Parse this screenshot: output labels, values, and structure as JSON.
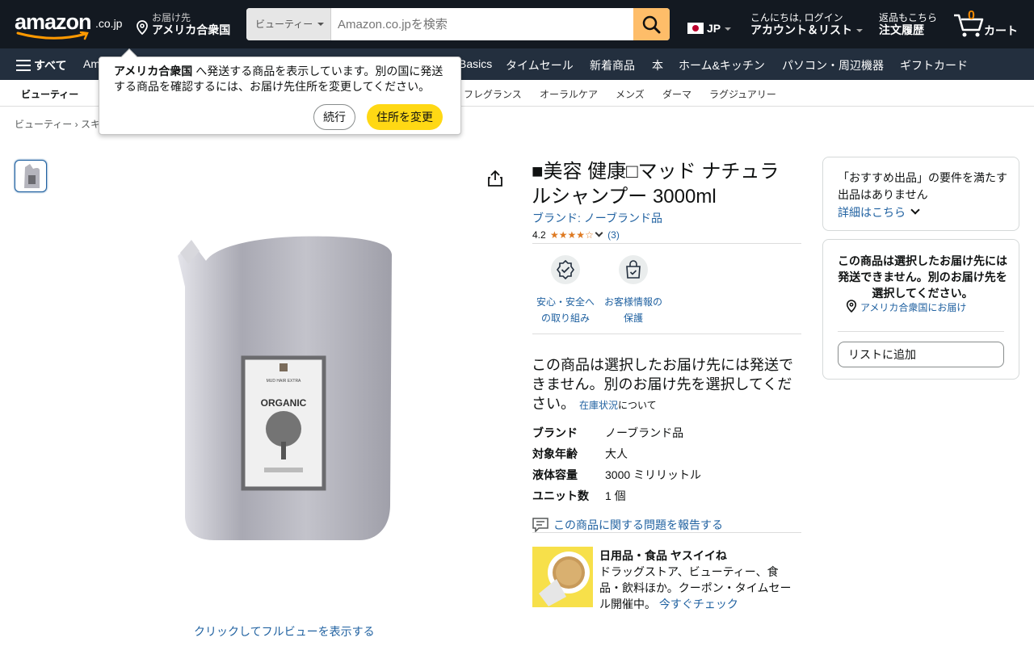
{
  "header": {
    "logo_text": "amazon",
    "logo_tld": ".co.jp",
    "deliver_line1": "お届け先",
    "deliver_line2": "アメリカ合衆国",
    "search_category": "ビューティー",
    "search_placeholder": "Amazon.co.jpを検索",
    "language": "JP",
    "account_line1": "こんにちは, ログイン",
    "account_line2": "アカウント＆リスト",
    "orders_line1": "返品もこちら",
    "orders_line2": "注文履歴",
    "cart_count": "0",
    "cart_label": "カート"
  },
  "nav": {
    "all_label": "すべて",
    "items": [
      "Am",
      "Basics",
      "タイムセール",
      "新着商品",
      "本",
      "ホーム&キッチン",
      "パソコン・周辺機器",
      "ギフトカード"
    ]
  },
  "subnav": {
    "items": [
      "ビューティー",
      "フレグランス",
      "オーラルケア",
      "メンズ",
      "ダーマ",
      "ラグジュアリー"
    ]
  },
  "breadcrumb": "ビューティー › スキ",
  "popover": {
    "country": "アメリカ合衆国",
    "message": " へ発送する商品を表示しています。別の国に発送する商品を確認するには、お届け先住所を変更してください。",
    "continue_label": "続行",
    "change_label": "住所を変更"
  },
  "product": {
    "title": "■美容 健康□マッド ナチュラルシャンプー 3000ml",
    "brand_link": "ブランド: ノーブランド品",
    "rating_value": "4.2",
    "rating_stars": 4.2,
    "rating_count": "(3)",
    "image_label": "ORGANIC",
    "image_sublabel": "MUD HAIR EXTRA",
    "full_view_link": "クリックしてフルビューを表示する",
    "badges": [
      {
        "icon": "safety-badge-icon",
        "label_l1": "安心・安全へ",
        "label_l2": "の取り組み"
      },
      {
        "icon": "customer-info-bag-icon",
        "label_l1": "お客様情報の",
        "label_l2": "保護"
      }
    ],
    "no_ship_text": "この商品は選択したお届け先には発送できません。別のお届け先を選択してください。",
    "stock_link": "在庫状況",
    "stock_suffix": "について",
    "specs": [
      {
        "key": "ブランド",
        "value": "ノーブランド品"
      },
      {
        "key": "対象年齢",
        "value": "大人"
      },
      {
        "key": "液体容量",
        "value": "3000 ミリリットル"
      },
      {
        "key": "ユニット数",
        "value": "1 個"
      }
    ],
    "report_link": "この商品に関する問題を報告する",
    "promo": {
      "heading": "日用品・食品 ヤスイイね",
      "body": "ドラッグストア、ビューティー、食品・飲料ほか。クーポン・タイムセール開催中。",
      "link": "今すぐチェック"
    }
  },
  "buybox": {
    "featured_text": "「おすすめ出品」の要件を満たす出品はありません",
    "details_link": "詳細はこちら",
    "cannot_ship_text": "この商品は選択したお届け先には発送できません。別のお届け先を選択してください。",
    "location_link": "アメリカ合衆国にお届け",
    "add_to_list": "リストに追加"
  },
  "colors": {
    "header_bg": "#131921",
    "nav_bg": "#232f3e",
    "search_button": "#febd69",
    "primary_button": "#ffd814",
    "link": "#2162a1",
    "star": "#de7921"
  }
}
